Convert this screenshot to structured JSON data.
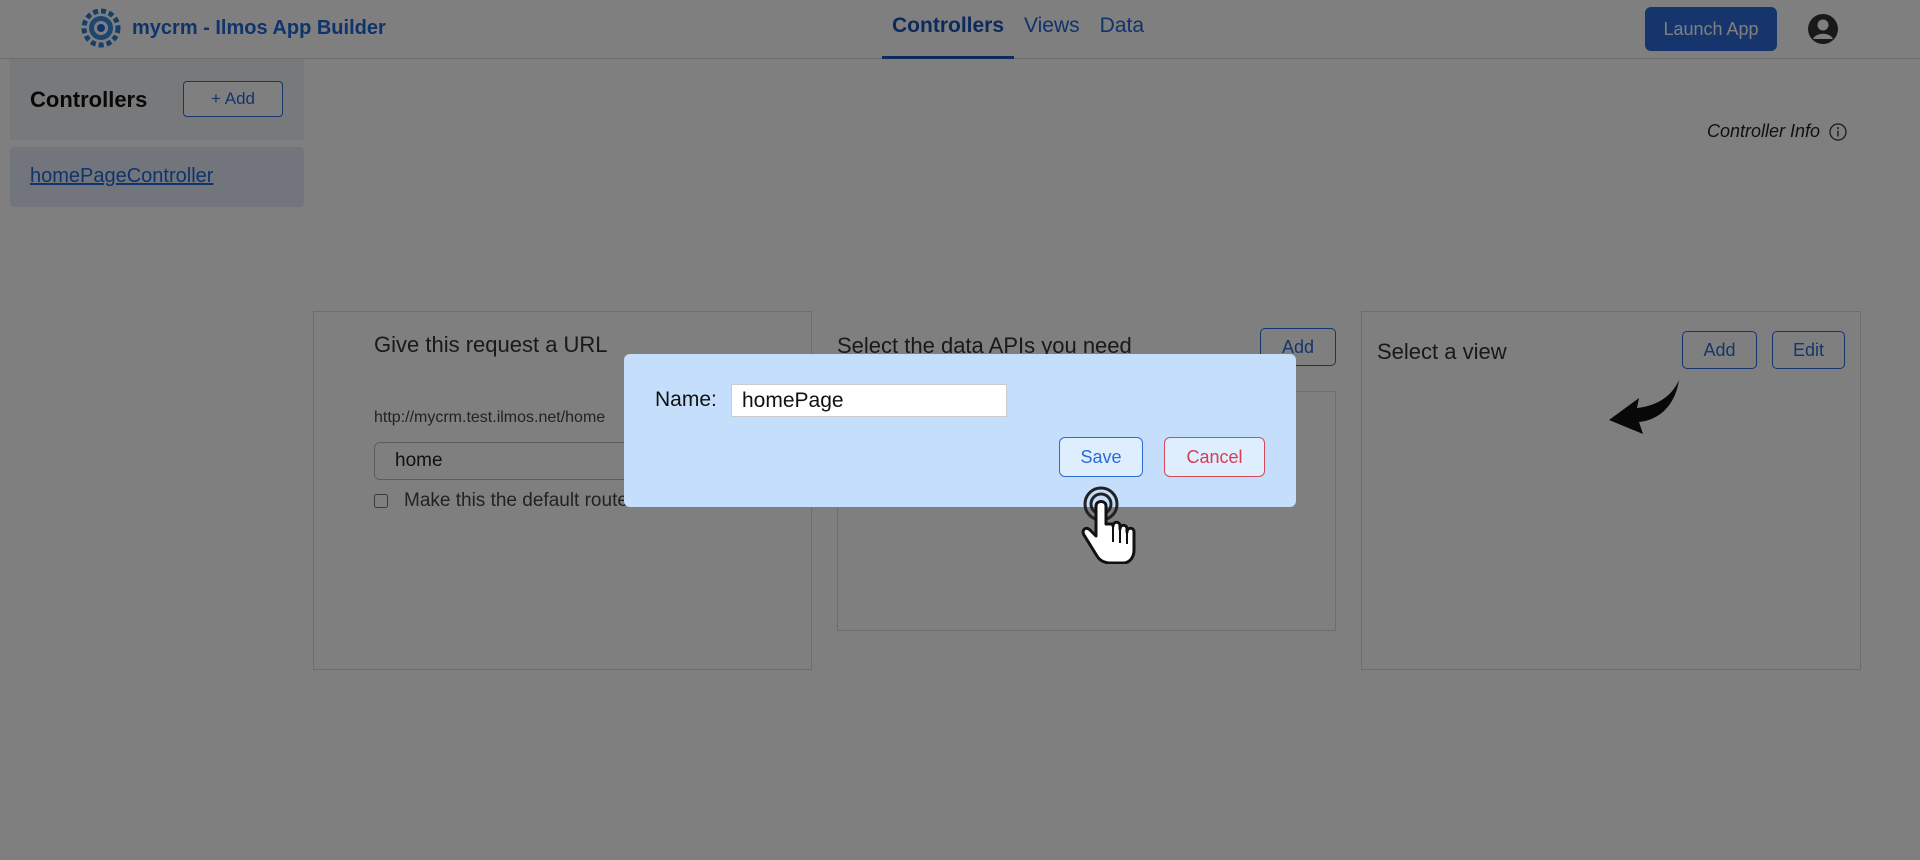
{
  "app": {
    "title": "mycrm - Ilmos App Builder",
    "logo_icon": "gear-logo-icon",
    "brand_color": "#1f66d6"
  },
  "nav": {
    "tabs": [
      {
        "label": "Controllers",
        "active": true
      },
      {
        "label": "Views",
        "active": false
      },
      {
        "label": "Data",
        "active": false
      }
    ]
  },
  "header": {
    "launch_label": "Launch App",
    "user_icon": "user-avatar-icon"
  },
  "sidebar": {
    "title": "Controllers",
    "add_label": "+  Add",
    "items": [
      {
        "label": "homePageController",
        "selected": true
      }
    ]
  },
  "main": {
    "info_label": "Controller Info",
    "url_panel": {
      "title": "Give this request a URL",
      "url_prefix": "http://mycrm.test.ilmos.net/home",
      "route_value": "home",
      "default_label": "Make this the default route",
      "default_checked": false
    },
    "api_panel": {
      "title": "Select the data APIs you need",
      "add_label": "Add"
    },
    "view_panel": {
      "title": "Select a view",
      "add_label": "Add",
      "edit_label": "Edit"
    }
  },
  "modal": {
    "name_label": "Name:",
    "name_value": "homePage",
    "save_label": "Save",
    "cancel_label": "Cancel"
  },
  "colors": {
    "accent": "#2a6bd8",
    "danger": "#d04050",
    "modal_bg": "#c4defc",
    "overlay": "rgba(0,0,0,0.5)"
  }
}
